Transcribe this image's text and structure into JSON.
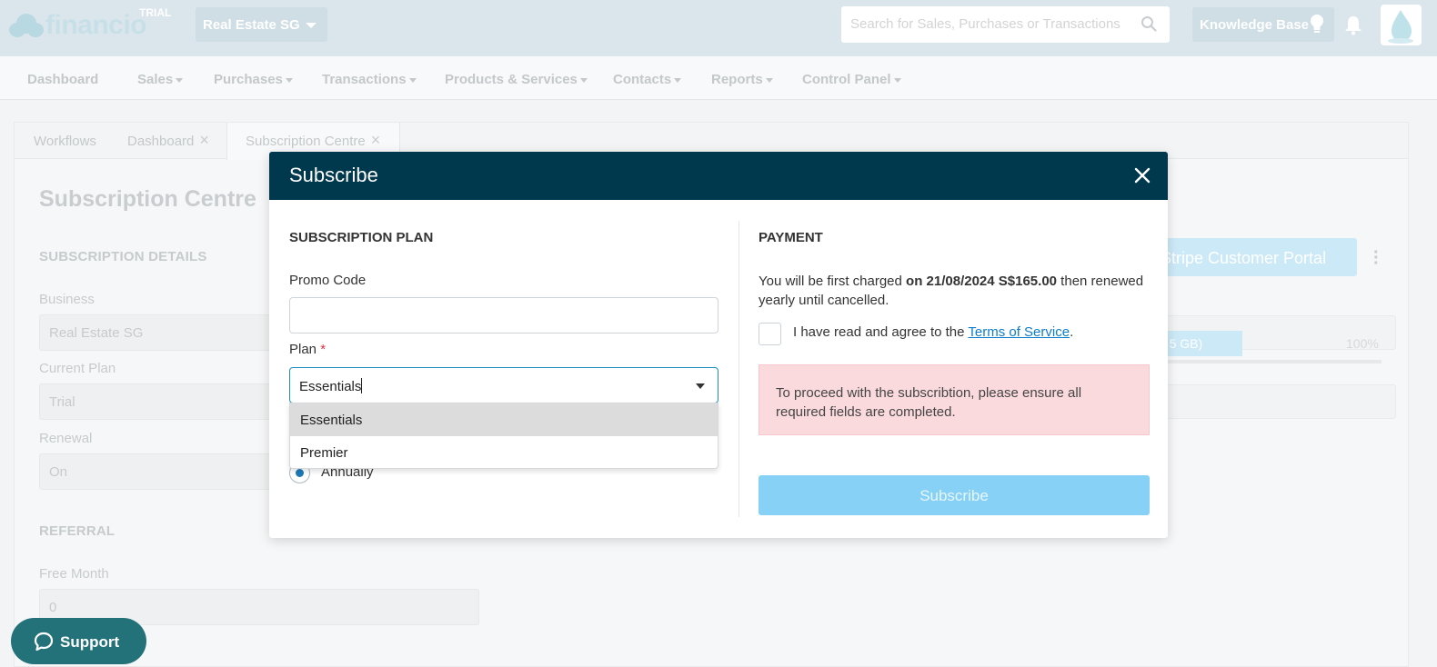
{
  "app": {
    "logo_text": "financio",
    "trial_badge": "TRIAL",
    "business": "Real Estate SG",
    "search_placeholder": "Search for Sales, Purchases or Transactions",
    "knowledge_base": "Knowledge Base"
  },
  "nav": [
    {
      "label": "Dashboard",
      "dropdown": false
    },
    {
      "label": "Sales",
      "dropdown": true
    },
    {
      "label": "Purchases",
      "dropdown": true
    },
    {
      "label": "Transactions",
      "dropdown": true
    },
    {
      "label": "Products & Services",
      "dropdown": true
    },
    {
      "label": "Contacts",
      "dropdown": true
    },
    {
      "label": "Reports",
      "dropdown": true
    },
    {
      "label": "Control Panel",
      "dropdown": true
    }
  ],
  "tabs": [
    {
      "label": "Workflows",
      "closable": false
    },
    {
      "label": "Dashboard",
      "closable": true
    },
    {
      "label": "Subscription Centre",
      "closable": true,
      "active": true
    }
  ],
  "page": {
    "title": "Subscription Centre",
    "subscription_details_heading": "SUBSCRIPTION DETAILS",
    "business_label": "Business",
    "business_value": "Real Estate SG",
    "current_plan_label": "Current Plan",
    "current_plan_value": "Trial",
    "renewal_label": "Renewal",
    "renewal_value": "On",
    "referral_heading": "REFERRAL",
    "free_month_label": "Free Month",
    "free_month_value": "0",
    "portal_button": "Stripe Customer Portal",
    "storage_text": "of 5 GB)",
    "storage_percent": "100%",
    "support_label": "Support"
  },
  "modal": {
    "title": "Subscribe",
    "plan_heading": "SUBSCRIPTION PLAN",
    "promo_label": "Promo Code",
    "promo_value": "",
    "plan_label": "Plan",
    "plan_value": "Essentials",
    "plan_options": [
      "Essentials",
      "Premier"
    ],
    "billing_option": "Annually",
    "payment_heading": "PAYMENT",
    "charge_prefix": "You will be first charged ",
    "charge_bold": "on 21/08/2024 S$165.00",
    "charge_suffix": " then renewed yearly until cancelled.",
    "agree_prefix": "I have read and agree to the ",
    "agree_link": "Terms of Service",
    "agree_suffix": ".",
    "alert_text": "To proceed with the subscribtion, please ensure all required fields are completed.",
    "subscribe_button": "Subscribe"
  },
  "colors": {
    "modal_header": "#00384d",
    "support_button": "#23727a",
    "subscribe_button": "#87d1f6",
    "alert_bg": "#fadadd",
    "link": "#0d7ccc"
  }
}
